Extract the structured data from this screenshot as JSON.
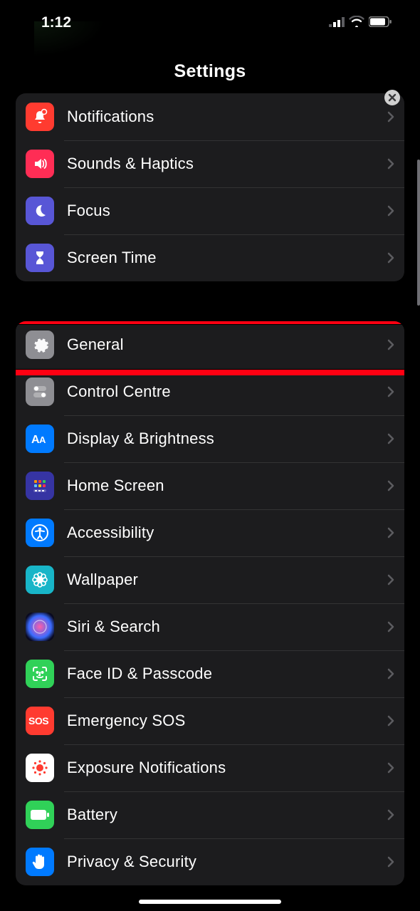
{
  "status": {
    "time": "1:12"
  },
  "page": {
    "title": "Settings"
  },
  "group1": [
    {
      "label": "Notifications",
      "icon": "bell-icon",
      "bg": "#ff3b30"
    },
    {
      "label": "Sounds & Haptics",
      "icon": "speaker-icon",
      "bg": "#ff2d55"
    },
    {
      "label": "Focus",
      "icon": "moon-icon",
      "bg": "#5856d6"
    },
    {
      "label": "Screen Time",
      "icon": "hourglass-icon",
      "bg": "#5856d6"
    }
  ],
  "group2": [
    {
      "label": "General",
      "icon": "gear-icon",
      "bg": "#8e8e93",
      "highlighted": true
    },
    {
      "label": "Control Centre",
      "icon": "toggles-icon",
      "bg": "#8e8e93"
    },
    {
      "label": "Display & Brightness",
      "icon": "aa-icon",
      "bg": "#007aff"
    },
    {
      "label": "Home Screen",
      "icon": "grid-icon",
      "bg": "#3634a3"
    },
    {
      "label": "Accessibility",
      "icon": "accessibility-icon",
      "bg": "#007aff"
    },
    {
      "label": "Wallpaper",
      "icon": "flower-icon",
      "bg": "#18b5c8"
    },
    {
      "label": "Siri & Search",
      "icon": "siri-icon",
      "bg": "#101010"
    },
    {
      "label": "Face ID & Passcode",
      "icon": "faceid-icon",
      "bg": "#30d158"
    },
    {
      "label": "Emergency SOS",
      "icon": "sos-icon",
      "bg": "#ff3b30"
    },
    {
      "label": "Exposure Notifications",
      "icon": "exposure-icon",
      "bg": "#ffffff"
    },
    {
      "label": "Battery",
      "icon": "battery-icon",
      "bg": "#30d158"
    },
    {
      "label": "Privacy & Security",
      "icon": "hand-icon",
      "bg": "#007aff"
    }
  ]
}
